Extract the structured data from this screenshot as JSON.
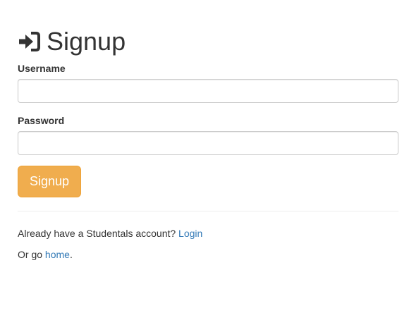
{
  "page": {
    "title": "Signup",
    "title_icon": "sign-in-icon"
  },
  "form": {
    "username_label": "Username",
    "username_value": "",
    "password_label": "Password",
    "password_value": "",
    "submit_label": "Signup"
  },
  "footer": {
    "account_prompt": "Already have a Studentals account?",
    "login_link": "Login",
    "home_prefix": "Or go",
    "home_link": "home",
    "home_suffix": "."
  },
  "colors": {
    "button": "#f0ad4e",
    "link": "#337ab7",
    "text": "#333333"
  }
}
